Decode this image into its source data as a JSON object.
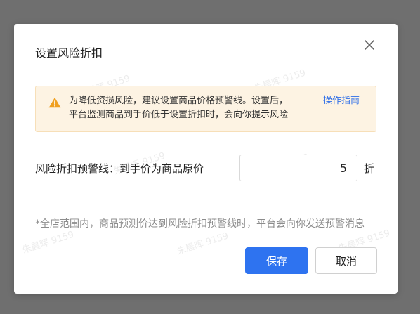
{
  "dialog": {
    "title": "设置风险折扣"
  },
  "alert": {
    "icon": "warning-icon",
    "line1": "为降低资损风险，建议设置商品价格预警线。设置后，",
    "line2": "平台监测商品到手价低于设置折扣时，会向你提示风险",
    "link": "操作指南",
    "color_bg": "#fdf3e3",
    "color_icon": "#f0a020",
    "color_link": "#2f6fe8"
  },
  "field": {
    "label": "风险折扣预警线：到手价为商品原价",
    "value": "5",
    "unit": "折"
  },
  "footnote": "*全店范围内，商品预测价达到风险折扣预警线时，平台会向你发送预警消息",
  "buttons": {
    "save": "保存",
    "cancel": "取消",
    "color_primary": "#2e73f0"
  },
  "watermark": {
    "text": "朱晨晖 9159"
  }
}
